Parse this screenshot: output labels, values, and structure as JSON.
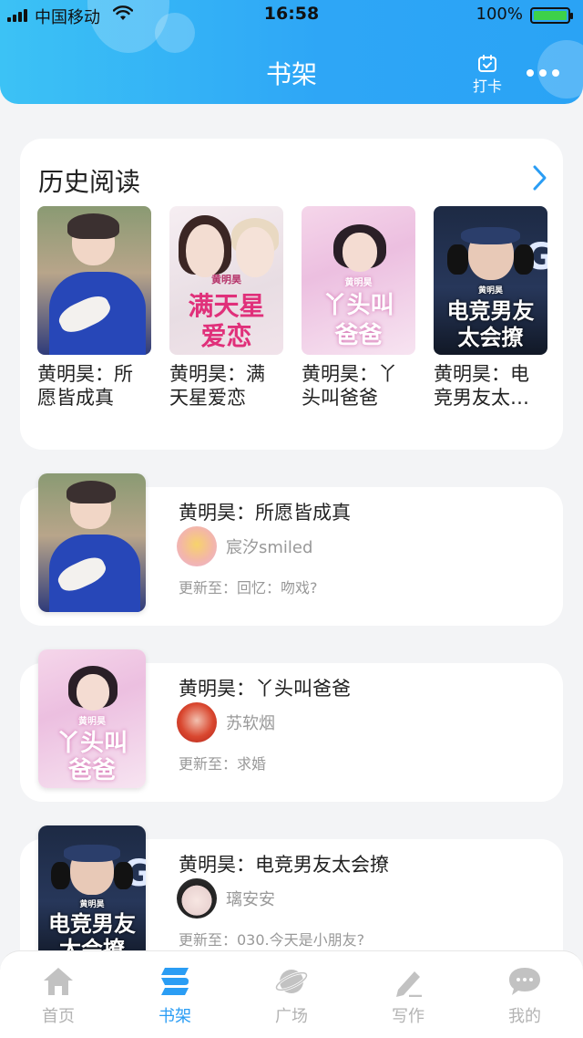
{
  "status_bar": {
    "carrier": "中国移动",
    "time": "16:58",
    "battery": "100%"
  },
  "header": {
    "title": "书架",
    "checkin_label": "打卡"
  },
  "history": {
    "title": "历史阅读",
    "items": [
      {
        "name": "黄明昊：所愿皆成真",
        "cover": "boy"
      },
      {
        "name": "黄明昊：满天星爱恋",
        "cover": "stars",
        "cover_text": [
          "满天星",
          "爱恋"
        ],
        "cover_tag": "黄明昊"
      },
      {
        "name": "黄明昊：丫头叫爸爸",
        "cover": "pink",
        "cover_text": [
          "丫头叫",
          "爸爸"
        ],
        "cover_tag": "黄明昊"
      },
      {
        "name": "黄明昊：电竞男友太会撩",
        "cover": "esports",
        "cover_text": [
          "电竞男友",
          "太会撩"
        ],
        "cover_tag": "黄明昊"
      }
    ]
  },
  "books": [
    {
      "title": "黄明昊：所愿皆成真",
      "author": "宸汐smiled",
      "update": "更新至：回忆：吻戏?",
      "cover": "boy"
    },
    {
      "title": "黄明昊：丫头叫爸爸",
      "author": "苏软烟",
      "update": "更新至：求婚",
      "cover": "pink",
      "cover_text": [
        "丫头叫",
        "爸爸"
      ],
      "cover_tag": "黄明昊"
    },
    {
      "title": "黄明昊：电竞男友太会撩",
      "author": "璃安安",
      "update": "更新至：030.今天是小朋友?",
      "cover": "esports",
      "cover_text": [
        "电竞男友",
        "太会撩"
      ],
      "cover_tag": "黄明昊"
    }
  ],
  "tabbar": {
    "items": [
      {
        "label": "首页",
        "icon": "home-icon",
        "active": false
      },
      {
        "label": "书架",
        "icon": "bookshelf-icon",
        "active": true
      },
      {
        "label": "广场",
        "icon": "planet-icon",
        "active": false
      },
      {
        "label": "写作",
        "icon": "pen-icon",
        "active": false
      },
      {
        "label": "我的",
        "icon": "chat-bubble-icon",
        "active": false
      }
    ]
  },
  "colors": {
    "header_gradient_start": "#3cc2f5",
    "header_gradient_end": "#2aa3f5",
    "accent": "#2a9df4",
    "tab_inactive": "#b3b3b3"
  }
}
